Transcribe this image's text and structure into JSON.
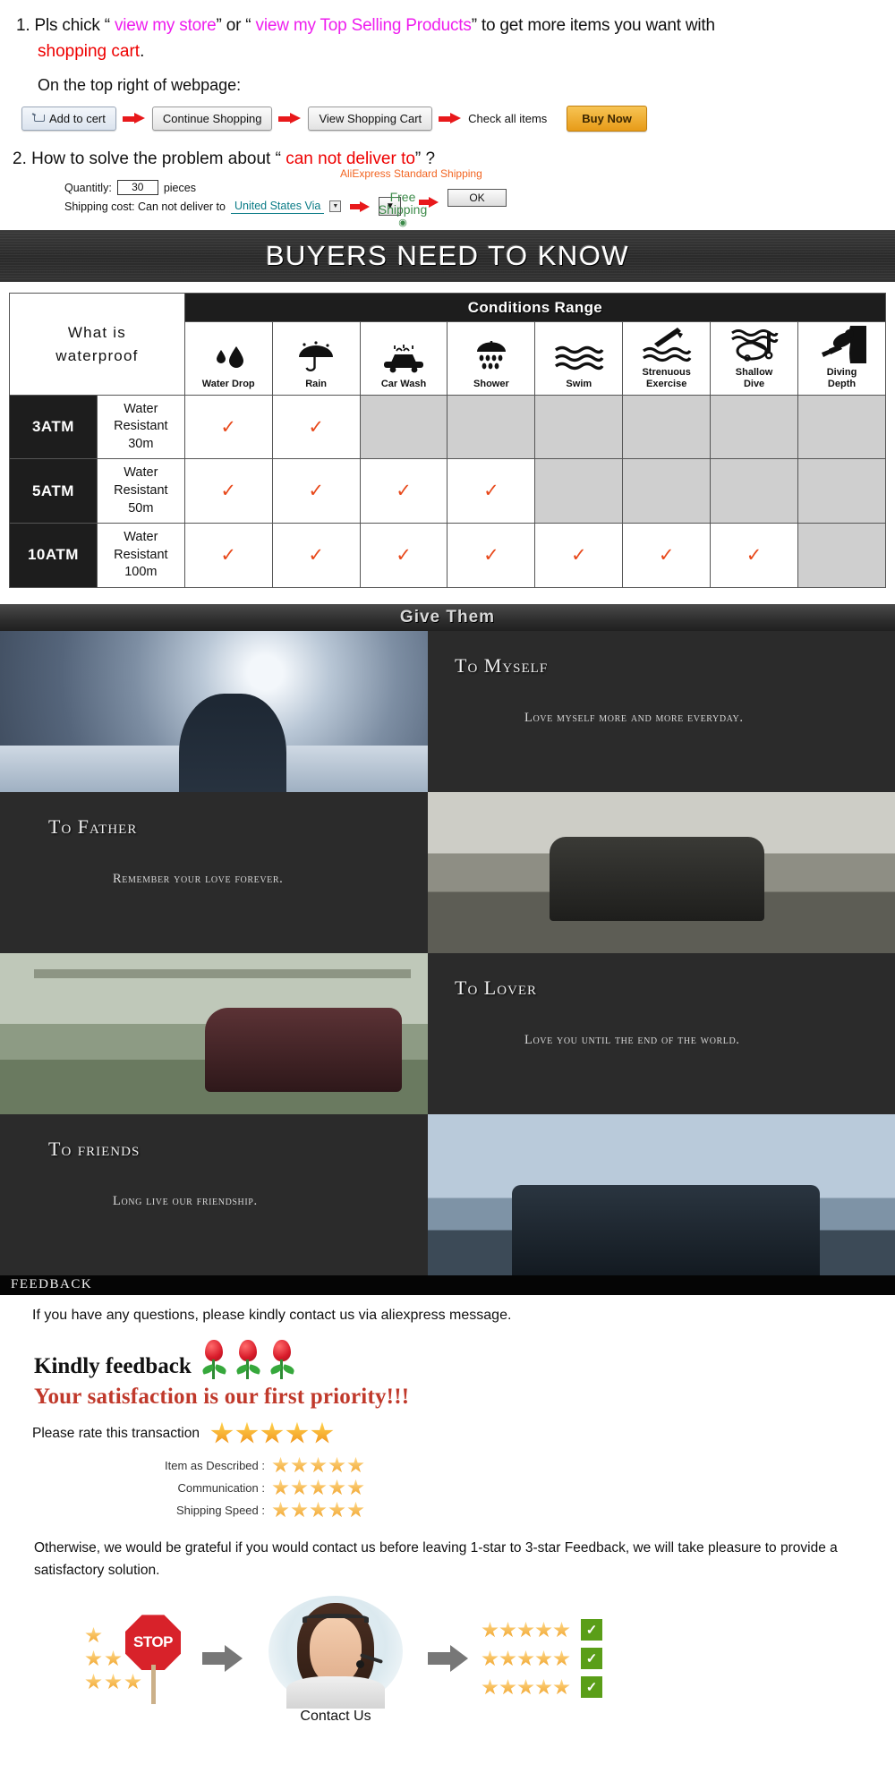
{
  "instructions": {
    "item1_prefix": "1. Pls chick “ ",
    "link_store": "view my store",
    "mid1": "” or “ ",
    "link_top": "view my Top Selling  Products",
    "mid2": "” to get more items you want with",
    "shopping_cart": "shopping cart",
    "period": ".",
    "subtitle": "On the top right of webpage:",
    "buttons": {
      "add_to_cart": "Add to cert",
      "continue_shopping": "Continue Shopping",
      "view_cart": "View Shopping Cart",
      "check_all": "Check all items",
      "buy_now": "Buy Now"
    },
    "item2_prefix": "2. How to solve the problem about “ ",
    "item2_red": "can not deliver to",
    "item2_suffix": "” ?",
    "shipping": {
      "qty_label": "Quantitly:",
      "qty_value": "30",
      "pieces": "pieces",
      "cost_label": "Shipping cost: Can not deliver to",
      "destination": "United States Via",
      "aliexpress_shipping": "AliExpress Standard Shipping",
      "free_line1": "Free",
      "free_line2": "Shipping",
      "radio_glyph": "◉",
      "ok": "OK",
      "caret": "▼"
    }
  },
  "banner": {
    "title": "BUYERS NEED TO KNOW"
  },
  "waterproof": {
    "corner_line1": "What is",
    "corner_line2": "waterproof",
    "conditions_header": "Conditions Range",
    "conditions": [
      {
        "label": "Water Drop",
        "icon": "water-drop-icon"
      },
      {
        "label": "Rain",
        "icon": "umbrella-rain-icon"
      },
      {
        "label": "Car Wash",
        "icon": "car-wash-icon"
      },
      {
        "label": "Shower",
        "icon": "shower-icon"
      },
      {
        "label": "Swim",
        "icon": "swim-waves-icon"
      },
      {
        "label": "Strenuous\nExercise",
        "icon": "strenuous-exercise-icon"
      },
      {
        "label": "Shallow\nDive",
        "icon": "shallow-dive-icon"
      },
      {
        "label": "Diving\nDepth",
        "icon": "diving-depth-icon"
      }
    ],
    "check_glyph": "✓",
    "rows": [
      {
        "atm": "3ATM",
        "resist_line1": "Water Resistant",
        "resist_line2": "30m",
        "checks": [
          true,
          true,
          false,
          false,
          false,
          false,
          false,
          false
        ]
      },
      {
        "atm": "5ATM",
        "resist_line1": "Water Resistant",
        "resist_line2": "50m",
        "checks": [
          true,
          true,
          true,
          true,
          false,
          false,
          false,
          false
        ]
      },
      {
        "atm": "10ATM",
        "resist_line1": "Water Resistant",
        "resist_line2": "100m",
        "checks": [
          true,
          true,
          true,
          true,
          true,
          true,
          true,
          false
        ]
      }
    ]
  },
  "give_them": {
    "header": "Give Them",
    "panels": [
      {
        "title": "To Myself",
        "body": "Love myself more and more everyday."
      },
      {
        "title": "To Father",
        "body": "Remember your love forever."
      },
      {
        "title": "To Lover",
        "body": "Love you until the end of the world."
      },
      {
        "title": "To friends",
        "body": "Long live our friendship."
      }
    ]
  },
  "feedback": {
    "header": "FEEDBACK",
    "question": "If you have any questions, please kindly contact us via aliexpress message.",
    "kindly": "Kindly feedback",
    "satisfaction": "Your satisfaction is our first priority!!!",
    "rate_label": "Please rate this transaction",
    "rate_stars": 5,
    "criteria": [
      {
        "label": "Item as Described :",
        "stars": 5
      },
      {
        "label": "Communication :",
        "stars": 5
      },
      {
        "label": "Shipping Speed :",
        "stars": 5
      }
    ],
    "note": "Otherwise, we would be grateful if you would contact us before leaving 1-star to 3-star Feedback, we will take pleasure to provide a satisfactory solution.",
    "flow": {
      "low_star_rows": [
        1,
        2,
        3
      ],
      "stop_text": "STOP",
      "contact_label": "Contact Us",
      "good_rows": [
        5,
        5,
        5
      ],
      "tick_glyph": "✓"
    }
  }
}
